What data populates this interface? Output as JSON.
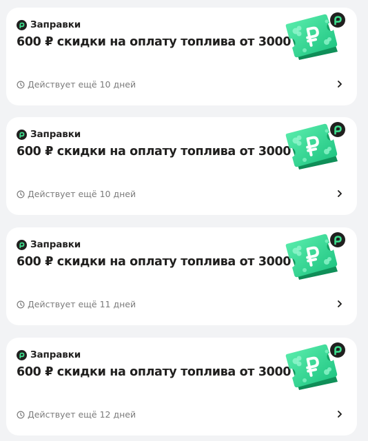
{
  "colors": {
    "brand_green": "#19b86a",
    "coupon_green": "#3ed894",
    "text": "#21201f",
    "muted": "#7b7b7b"
  },
  "cards": [
    {
      "brand": "Заправки",
      "title": "600 ₽ скидки на оплату топлива от 3000",
      "validity": "Действует ещё 10 дней",
      "icons": [
        "zapravki-logo-icon",
        "coupon-ruble-icon",
        "clock-icon",
        "chevron-right-icon"
      ]
    },
    {
      "brand": "Заправки",
      "title": "600 ₽ скидки на оплату топлива от 3000",
      "validity": "Действует ещё 10 дней",
      "icons": [
        "zapravki-logo-icon",
        "coupon-ruble-icon",
        "clock-icon",
        "chevron-right-icon"
      ]
    },
    {
      "brand": "Заправки",
      "title": "600 ₽ скидки на оплату топлива от 3000",
      "validity": "Действует ещё 11 дней",
      "icons": [
        "zapravki-logo-icon",
        "coupon-ruble-icon",
        "clock-icon",
        "chevron-right-icon"
      ]
    },
    {
      "brand": "Заправки",
      "title": "600 ₽ скидки на оплату топлива от 3000",
      "validity": "Действует ещё 12 дней",
      "icons": [
        "zapravki-logo-icon",
        "coupon-ruble-icon",
        "clock-icon",
        "chevron-right-icon"
      ]
    }
  ]
}
